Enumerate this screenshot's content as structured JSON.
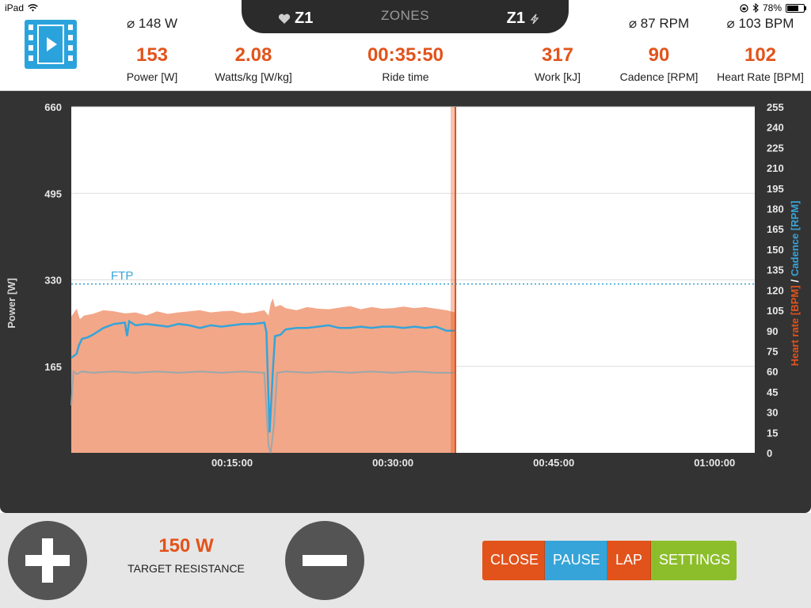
{
  "status_bar": {
    "device": "iPad",
    "battery": "78%",
    "battery_level": 0.78
  },
  "tiles": {
    "power": {
      "avg": "⌀ 148 W",
      "value": "153",
      "label": "Power [W]"
    },
    "wkg": {
      "value": "2.08",
      "label": "Watts/kg [W/kg]"
    },
    "ride_time": {
      "value": "00:35:50",
      "label": "Ride time"
    },
    "work": {
      "value": "317",
      "label": "Work [kJ]"
    },
    "cadence": {
      "avg": "⌀ 87 RPM",
      "value": "90",
      "label": "Cadence [RPM]"
    },
    "heart_rate": {
      "avg": "⌀ 103 BPM",
      "value": "102",
      "label": "Heart Rate [BPM]"
    }
  },
  "zones": {
    "title": "ZONES",
    "heart_zone": "Z1",
    "power_zone": "Z1"
  },
  "chart": {
    "left_axis_title": "Power [W]",
    "right_axis_title_hr": "Heart rate [BPM]",
    "right_axis_sep": "/",
    "right_axis_title_cad": "Cadence [RPM]",
    "ftp_label": "FTP"
  },
  "chart_data": {
    "type": "area",
    "title": "",
    "xlabel": "",
    "ylabel": "Power [W]",
    "y2label": "Heart rate [BPM] / Cadence [RPM]",
    "x_unit": "minutes",
    "xlim": [
      0,
      63.75
    ],
    "ylim": [
      0,
      660
    ],
    "y2lim": [
      0,
      255
    ],
    "x_ticks": [
      {
        "value": 15,
        "label": "00:15:00"
      },
      {
        "value": 30,
        "label": "00:30:00"
      },
      {
        "value": 45,
        "label": "00:45:00"
      },
      {
        "value": 60,
        "label": "01:00:00"
      }
    ],
    "y_ticks": [
      165,
      330,
      495,
      660
    ],
    "y2_ticks": [
      0,
      15,
      30,
      45,
      60,
      75,
      90,
      105,
      120,
      135,
      150,
      165,
      180,
      195,
      210,
      225,
      240,
      255
    ],
    "ftp": 322,
    "current_position": 35.83,
    "grid": true,
    "series": [
      {
        "name": "Power [W]",
        "axis": "left",
        "kind": "area",
        "color": "#f2a788",
        "x": [
          0,
          0.5,
          0.8,
          1.2,
          2,
          3,
          4,
          5,
          6,
          7,
          8,
          9,
          10,
          11,
          12,
          13,
          14,
          15,
          16,
          17,
          18,
          18.4,
          18.6,
          18.8,
          19,
          19.5,
          20,
          21,
          22,
          23,
          24,
          25,
          26,
          27,
          28,
          29,
          30,
          31,
          32,
          33,
          34,
          35,
          35.8
        ],
        "values": [
          260,
          275,
          255,
          262,
          265,
          272,
          270,
          266,
          268,
          262,
          270,
          265,
          268,
          270,
          272,
          268,
          270,
          271,
          266,
          268,
          272,
          262,
          285,
          295,
          278,
          282,
          276,
          272,
          278,
          275,
          274,
          277,
          280,
          274,
          278,
          275,
          276,
          279,
          276,
          278,
          275,
          272,
          268
        ]
      },
      {
        "name": "Heart rate [BPM]",
        "axis": "right",
        "kind": "line",
        "color": "#36a4d9",
        "x": [
          0,
          0.5,
          0.7,
          1,
          1.5,
          2,
          3,
          4,
          5,
          5.2,
          5.4,
          6,
          7,
          8,
          9,
          10,
          11,
          12,
          13,
          14,
          15,
          16,
          17,
          18,
          18.2,
          18.5,
          18.8,
          19,
          19.5,
          20,
          21,
          22,
          23,
          24,
          25,
          26,
          27,
          28,
          29,
          30,
          31,
          32,
          33,
          34,
          35,
          35.8
        ],
        "values": [
          70,
          73,
          79,
          84,
          85,
          87,
          92,
          95,
          96,
          86,
          97,
          94,
          95,
          94,
          93,
          95,
          94,
          92,
          94,
          93,
          94,
          95,
          95,
          96,
          89,
          15,
          60,
          86,
          87,
          91,
          92,
          92,
          93,
          94,
          92,
          92,
          93,
          92,
          93,
          93,
          92,
          93,
          92,
          93,
          90,
          90
        ]
      },
      {
        "name": "Cadence [RPM]",
        "axis": "right",
        "kind": "line",
        "color": "#9aa7ad",
        "x": [
          0,
          0.2,
          0.5,
          1,
          2,
          4,
          6,
          8,
          10,
          12,
          14,
          16,
          18,
          18.4,
          18.6,
          18.9,
          19.2,
          20,
          22,
          24,
          26,
          28,
          30,
          32,
          34,
          35.8
        ],
        "values": [
          35,
          60,
          58,
          60,
          59,
          60,
          59,
          60,
          59,
          60,
          59,
          60,
          59,
          5,
          0,
          20,
          59,
          60,
          59,
          60,
          59,
          60,
          59,
          60,
          59,
          59
        ]
      }
    ]
  },
  "controls": {
    "target_value": "150 W",
    "target_label": "TARGET RESISTANCE",
    "buttons": {
      "close": "CLOSE",
      "pause": "PAUSE",
      "lap": "LAP",
      "settings": "SETTINGS"
    }
  }
}
